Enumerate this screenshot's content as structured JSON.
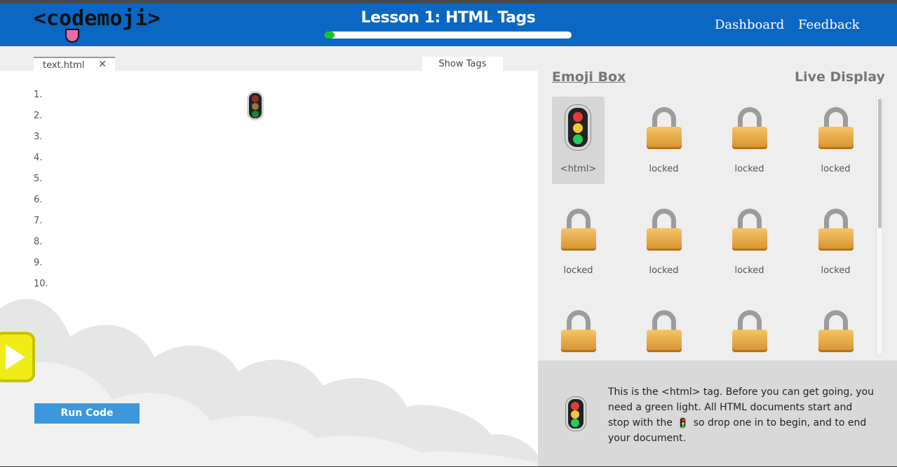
{
  "header": {
    "logo": "<codemoji>",
    "lesson_title": "Lesson 1: HTML Tags",
    "progress": 0.04,
    "nav": {
      "dashboard": "Dashboard",
      "feedback": "Feedback"
    }
  },
  "editor": {
    "tab_label": "text.html",
    "tab_close": "✕",
    "show_tags": "Show Tags",
    "line_numbers": [
      "1.",
      "2.",
      "3.",
      "4.",
      "5.",
      "6.",
      "7.",
      "8.",
      "9.",
      "10."
    ],
    "run_button": "Run Code"
  },
  "panel": {
    "emoji_box_title": "Emoji Box",
    "live_display_title": "Live Display",
    "cells": [
      {
        "label": "<html>",
        "icon": "traffic-light-icon",
        "locked": false
      },
      {
        "label": "locked",
        "icon": "lock-icon",
        "locked": true
      },
      {
        "label": "locked",
        "icon": "lock-icon",
        "locked": true
      },
      {
        "label": "locked",
        "icon": "lock-icon",
        "locked": true
      },
      {
        "label": "locked",
        "icon": "lock-icon",
        "locked": true
      },
      {
        "label": "locked",
        "icon": "lock-icon",
        "locked": true
      },
      {
        "label": "locked",
        "icon": "lock-icon",
        "locked": true
      },
      {
        "label": "locked",
        "icon": "lock-icon",
        "locked": true
      },
      {
        "label": "",
        "icon": "lock-icon",
        "locked": true
      },
      {
        "label": "",
        "icon": "lock-icon",
        "locked": true
      },
      {
        "label": "",
        "icon": "lock-icon",
        "locked": true
      },
      {
        "label": "",
        "icon": "lock-icon",
        "locked": true
      }
    ]
  },
  "info": {
    "text_before": "This is the <html> tag. Before you can get going, you need a green light. All HTML documents start and stop with the",
    "text_after": "so drop one in to begin, and to end your document."
  },
  "colors": {
    "header_blue": "#0a67c4",
    "progress_green": "#18c418",
    "run_button": "#3d97dc",
    "play_button": "#f0ec16"
  }
}
